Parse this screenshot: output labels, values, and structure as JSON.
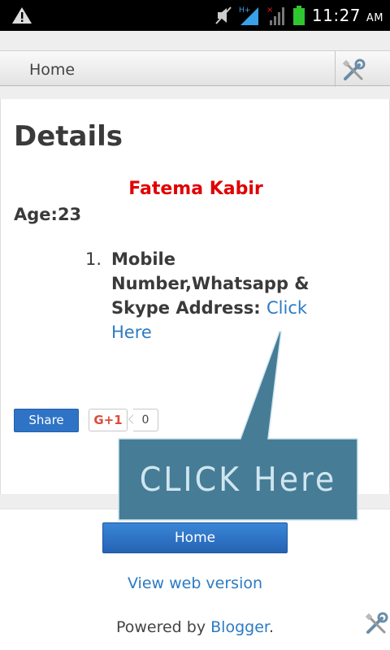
{
  "status_bar": {
    "clock": "11:27",
    "ampm": "AM",
    "icons": [
      "warning-icon",
      "mute-icon",
      "hplus-signal-icon",
      "no-signal-icon",
      "battery-icon"
    ],
    "battery_color": "#2fc62f"
  },
  "header": {
    "home_label": "Home",
    "tools_icon": "wrench-screwdriver-icon"
  },
  "post": {
    "title": "Details",
    "name": "Fatema Kabir",
    "name_color": "#e00000",
    "age_label": "Age:",
    "age_value": "23",
    "list": [
      {
        "number": "1.",
        "text": "Mobile Number,Whatsapp & Skype Address: ",
        "link": "Click Here"
      }
    ]
  },
  "share": {
    "share_label": "Share",
    "gplus_label": "G+1",
    "gplus_count": "0"
  },
  "callout": {
    "text": "CLICK Here",
    "fill": "#467c96",
    "text_color": "#cfe6ef"
  },
  "footer": {
    "home_button": "Home",
    "web_version": "View web version",
    "powered_prefix": "Powered by ",
    "powered_link": "Blogger",
    "powered_suffix": ".",
    "tools_icon": "wrench-screwdriver-icon"
  },
  "colors": {
    "link": "#2b7bc4",
    "button_blue": "#2e73c6"
  }
}
